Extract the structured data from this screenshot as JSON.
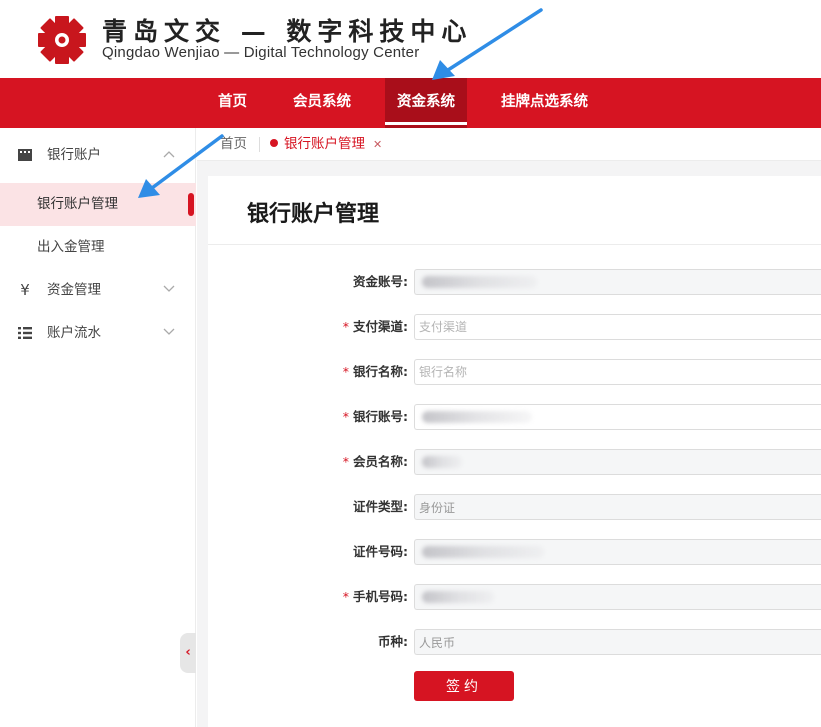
{
  "brand": {
    "name_cn": "青岛文交 — 数字科技中心",
    "name_en": "Qingdao Wenjiao — Digital Technology Center"
  },
  "topnav": {
    "items": [
      {
        "label": "首页"
      },
      {
        "label": "会员系统"
      },
      {
        "label": "资金系统"
      },
      {
        "label": "挂牌点选系统"
      }
    ],
    "active": "资金系统"
  },
  "sidebar": {
    "groups": [
      {
        "label": "银行账户",
        "icon": "film-icon",
        "expanded": true,
        "children": [
          {
            "label": "银行账户管理",
            "active": true
          },
          {
            "label": "出入金管理"
          }
        ]
      },
      {
        "label": "资金管理",
        "icon": "yen-icon",
        "expanded": false
      },
      {
        "label": "账户流水",
        "icon": "list-icon",
        "expanded": false
      }
    ]
  },
  "tabs": {
    "home": "首页",
    "active": "银行账户管理"
  },
  "panel": {
    "title": "银行账户管理",
    "fields": [
      {
        "label": "资金账号:",
        "required": false,
        "value": "",
        "placeholder": "",
        "masked": true
      },
      {
        "label": "支付渠道:",
        "required": true,
        "value": "",
        "placeholder": "支付渠道",
        "masked": false
      },
      {
        "label": "银行名称:",
        "required": true,
        "value": "",
        "placeholder": "银行名称",
        "masked": false
      },
      {
        "label": "银行账号:",
        "required": true,
        "value": "",
        "placeholder": "",
        "masked": true
      },
      {
        "label": "会员名称:",
        "required": true,
        "value": "",
        "placeholder": "",
        "masked": true
      },
      {
        "label": "证件类型:",
        "required": false,
        "value": "身份证",
        "placeholder": "",
        "masked": false
      },
      {
        "label": "证件号码:",
        "required": false,
        "value": "",
        "placeholder": "",
        "masked": true
      },
      {
        "label": "手机号码:",
        "required": true,
        "value": "",
        "placeholder": "",
        "masked": true
      },
      {
        "label": "币种:",
        "required": false,
        "value": "人民币",
        "placeholder": "",
        "masked": false
      }
    ],
    "submit_label": "签约"
  },
  "colors": {
    "brand_red": "#d61422",
    "nav_active": "#a90e1a",
    "annotation_arrow": "#2f8de6"
  }
}
